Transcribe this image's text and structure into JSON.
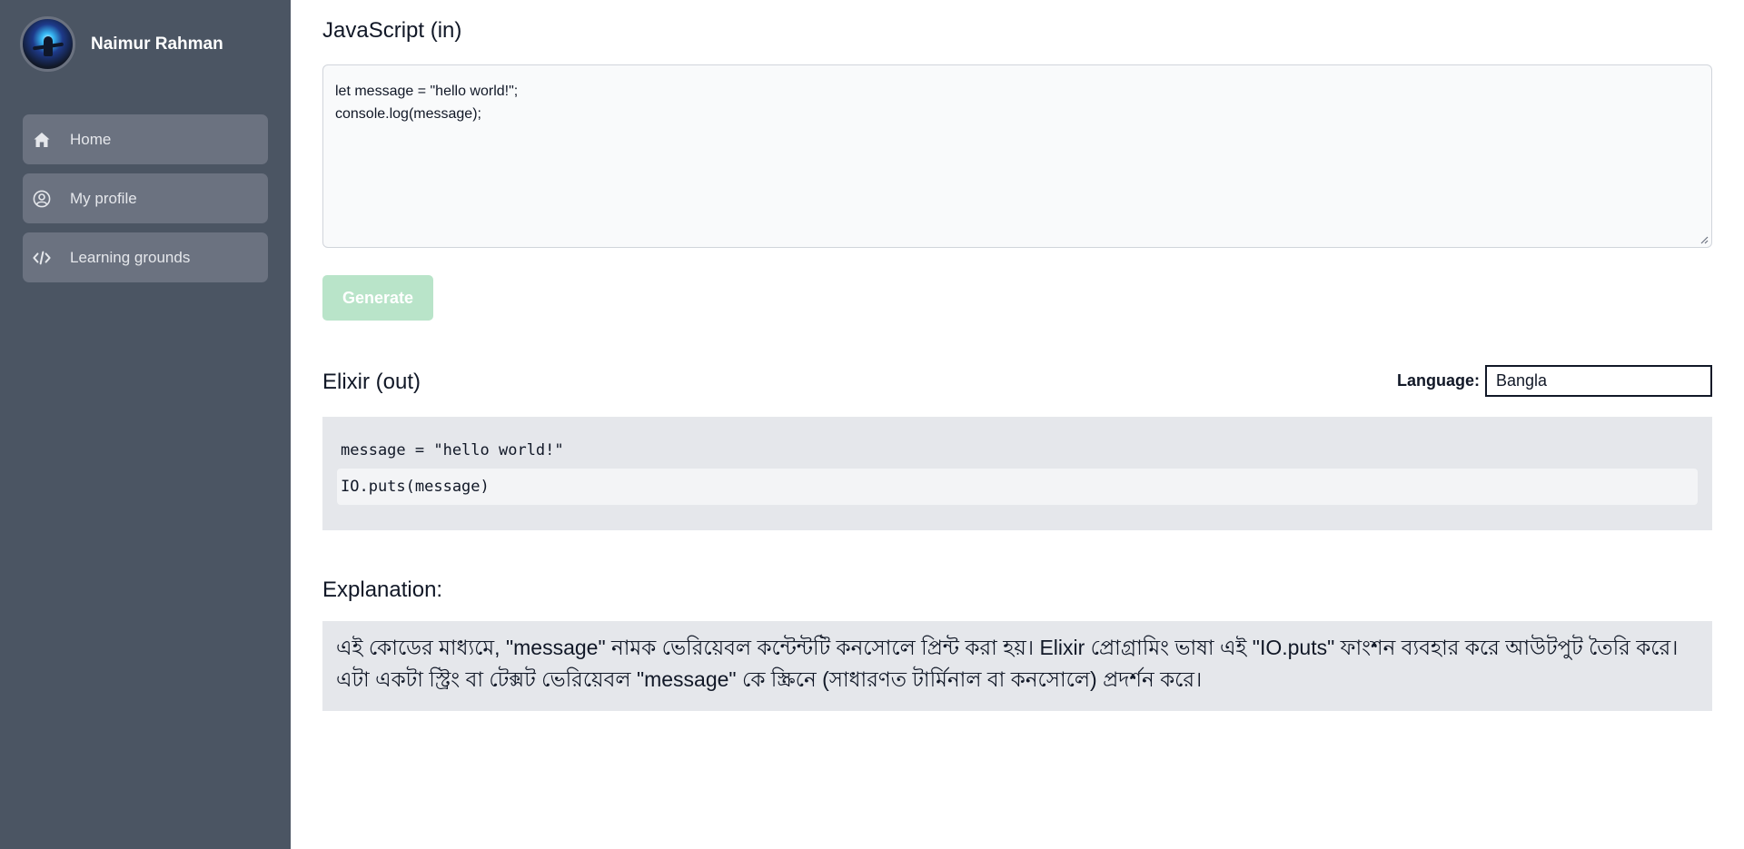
{
  "sidebar": {
    "user_name": "Naimur Rahman",
    "items": [
      {
        "label": "Home",
        "icon": "home-icon"
      },
      {
        "label": "My profile",
        "icon": "user-circle-icon"
      },
      {
        "label": "Learning grounds",
        "icon": "code-icon"
      }
    ]
  },
  "input": {
    "title": "JavaScript (in)",
    "code": "let message = \"hello world!\";\nconsole.log(message);"
  },
  "generate_label": "Generate",
  "output": {
    "title": "Elixir (out)",
    "language_label": "Language:",
    "language_value": "Bangla",
    "lines": [
      "message = \"hello world!\"",
      "IO.puts(message)"
    ]
  },
  "explanation": {
    "title": "Explanation:",
    "text": "এই কোডের মাধ্যমে, \"message\" নামক ভেরিয়েবল কন্টেন্টটি কনসোলে প্রিন্ট করা হয়। Elixir প্রোগ্রামিং ভাষা এই \"IO.puts\" ফাংশন ব্যবহার করে আউটপুট তৈরি করে। এটা একটা স্ট্রিং বা টেক্সট ভেরিয়েবল \"message\" কে স্ক্রিনে (সাধারণত টার্মিনাল বা কনসোলে) প্রদর্শন করে।"
  },
  "colors": {
    "sidebar_bg": "#4b5563",
    "nav_item_bg": "#6b7280",
    "generate_disabled": "#b9e4c9",
    "code_panel_bg": "#e5e7eb"
  }
}
